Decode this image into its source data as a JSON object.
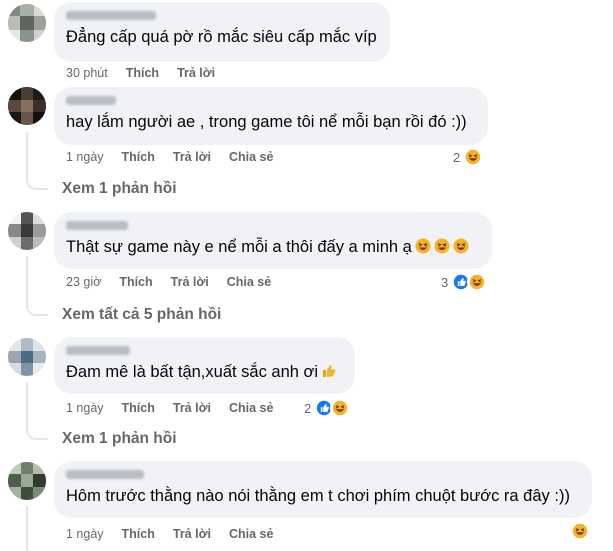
{
  "comments": [
    {
      "text": "Đẳng cấp quá pờ rồ mắc siêu cấp mắc víp",
      "time": "30 phút",
      "like": "Thích",
      "reply": "Trả lời",
      "share": "",
      "reaction_count": "",
      "view_replies": ""
    },
    {
      "text": "hay lắm người ae , trong game tôi nể mỗi bạn rồi đó :))",
      "time": "1 ngày",
      "like": "Thích",
      "reply": "Trả lời",
      "share": "Chia sẻ",
      "reaction_count": "2",
      "view_replies": "Xem 1 phản hồi"
    },
    {
      "text": "Thật sự game này e nể mỗi a thôi đấy a minh ạ",
      "time": "23 giờ",
      "like": "Thích",
      "reply": "Trả lời",
      "share": "Chia sẻ",
      "reaction_count": "3",
      "view_replies": "Xem tất cả 5 phản hồi"
    },
    {
      "text": "Đam mê là bất tận,xuất sắc anh ơi",
      "time": "1 ngày",
      "like": "Thích",
      "reply": "Trả lời",
      "share": "Chia sẻ",
      "reaction_count": "2",
      "view_replies": "Xem 1 phản hồi"
    },
    {
      "text": "Hôm trước thằng nào nói thằng em t chơi phím chuột bước ra đây :))",
      "time": "1 ngày",
      "like": "Thích",
      "reply": "Trả lời",
      "share": "Chia sẻ",
      "reaction_count": "",
      "view_replies": ""
    }
  ],
  "colors": {
    "bubble": "#f0f2f5",
    "meta_text": "#65676b",
    "like_blue": "#1877f2",
    "haha_yellow": "#f7b125"
  },
  "icons": [
    "like-reaction-icon",
    "haha-reaction-icon",
    "grinning-squinting-emoji",
    "thumbs-up-emoji"
  ]
}
